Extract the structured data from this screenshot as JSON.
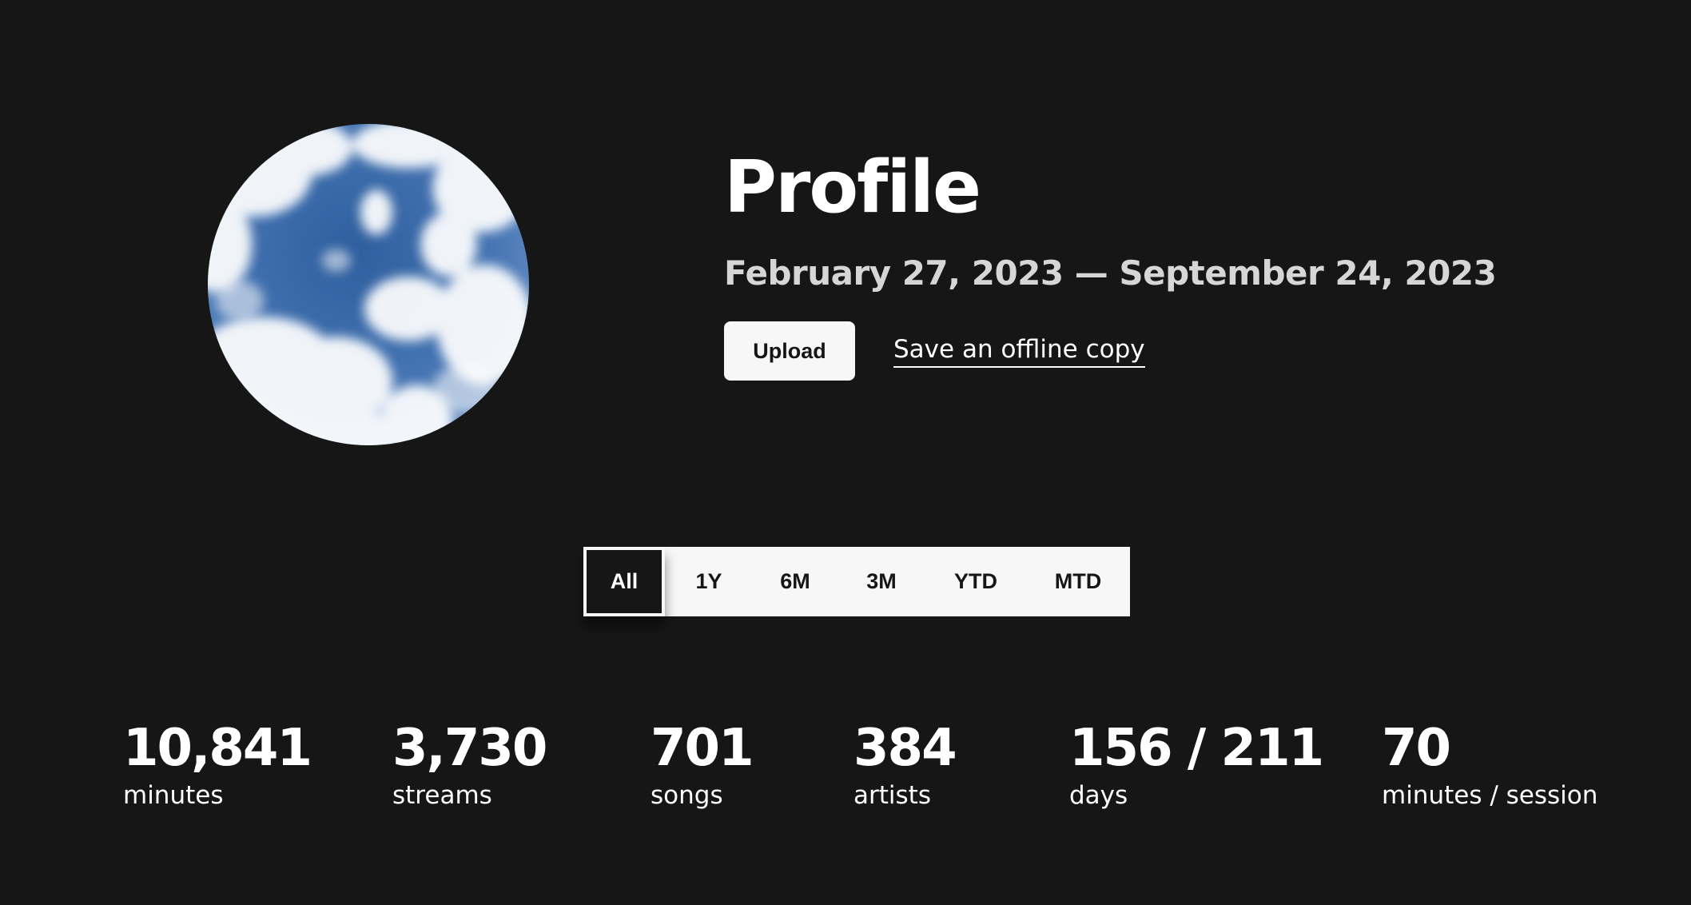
{
  "profile": {
    "avatar_icon": "sky-clouds-avatar",
    "title": "Profile",
    "date_range": "February 27, 2023 — September 24, 2023",
    "upload_label": "Upload",
    "offline_label": "Save an offline copy"
  },
  "range_tabs": {
    "selected": "All",
    "items": [
      {
        "label": "All"
      },
      {
        "label": "1Y"
      },
      {
        "label": "6M"
      },
      {
        "label": "3M"
      },
      {
        "label": "YTD"
      },
      {
        "label": "MTD"
      }
    ]
  },
  "stats": [
    {
      "value": "10,841",
      "label": "minutes"
    },
    {
      "value": "3,730",
      "label": "streams"
    },
    {
      "value": "701",
      "label": "songs"
    },
    {
      "value": "384",
      "label": "artists"
    },
    {
      "value": "156 / 211",
      "label": "days"
    },
    {
      "value": "70",
      "label": "minutes / session"
    }
  ],
  "colors": {
    "background": "#161616",
    "text": "#ffffff",
    "subtext": "#d6d6d6",
    "button_bg": "#f7f7f7",
    "sky_blue": "#3c6aa8"
  }
}
